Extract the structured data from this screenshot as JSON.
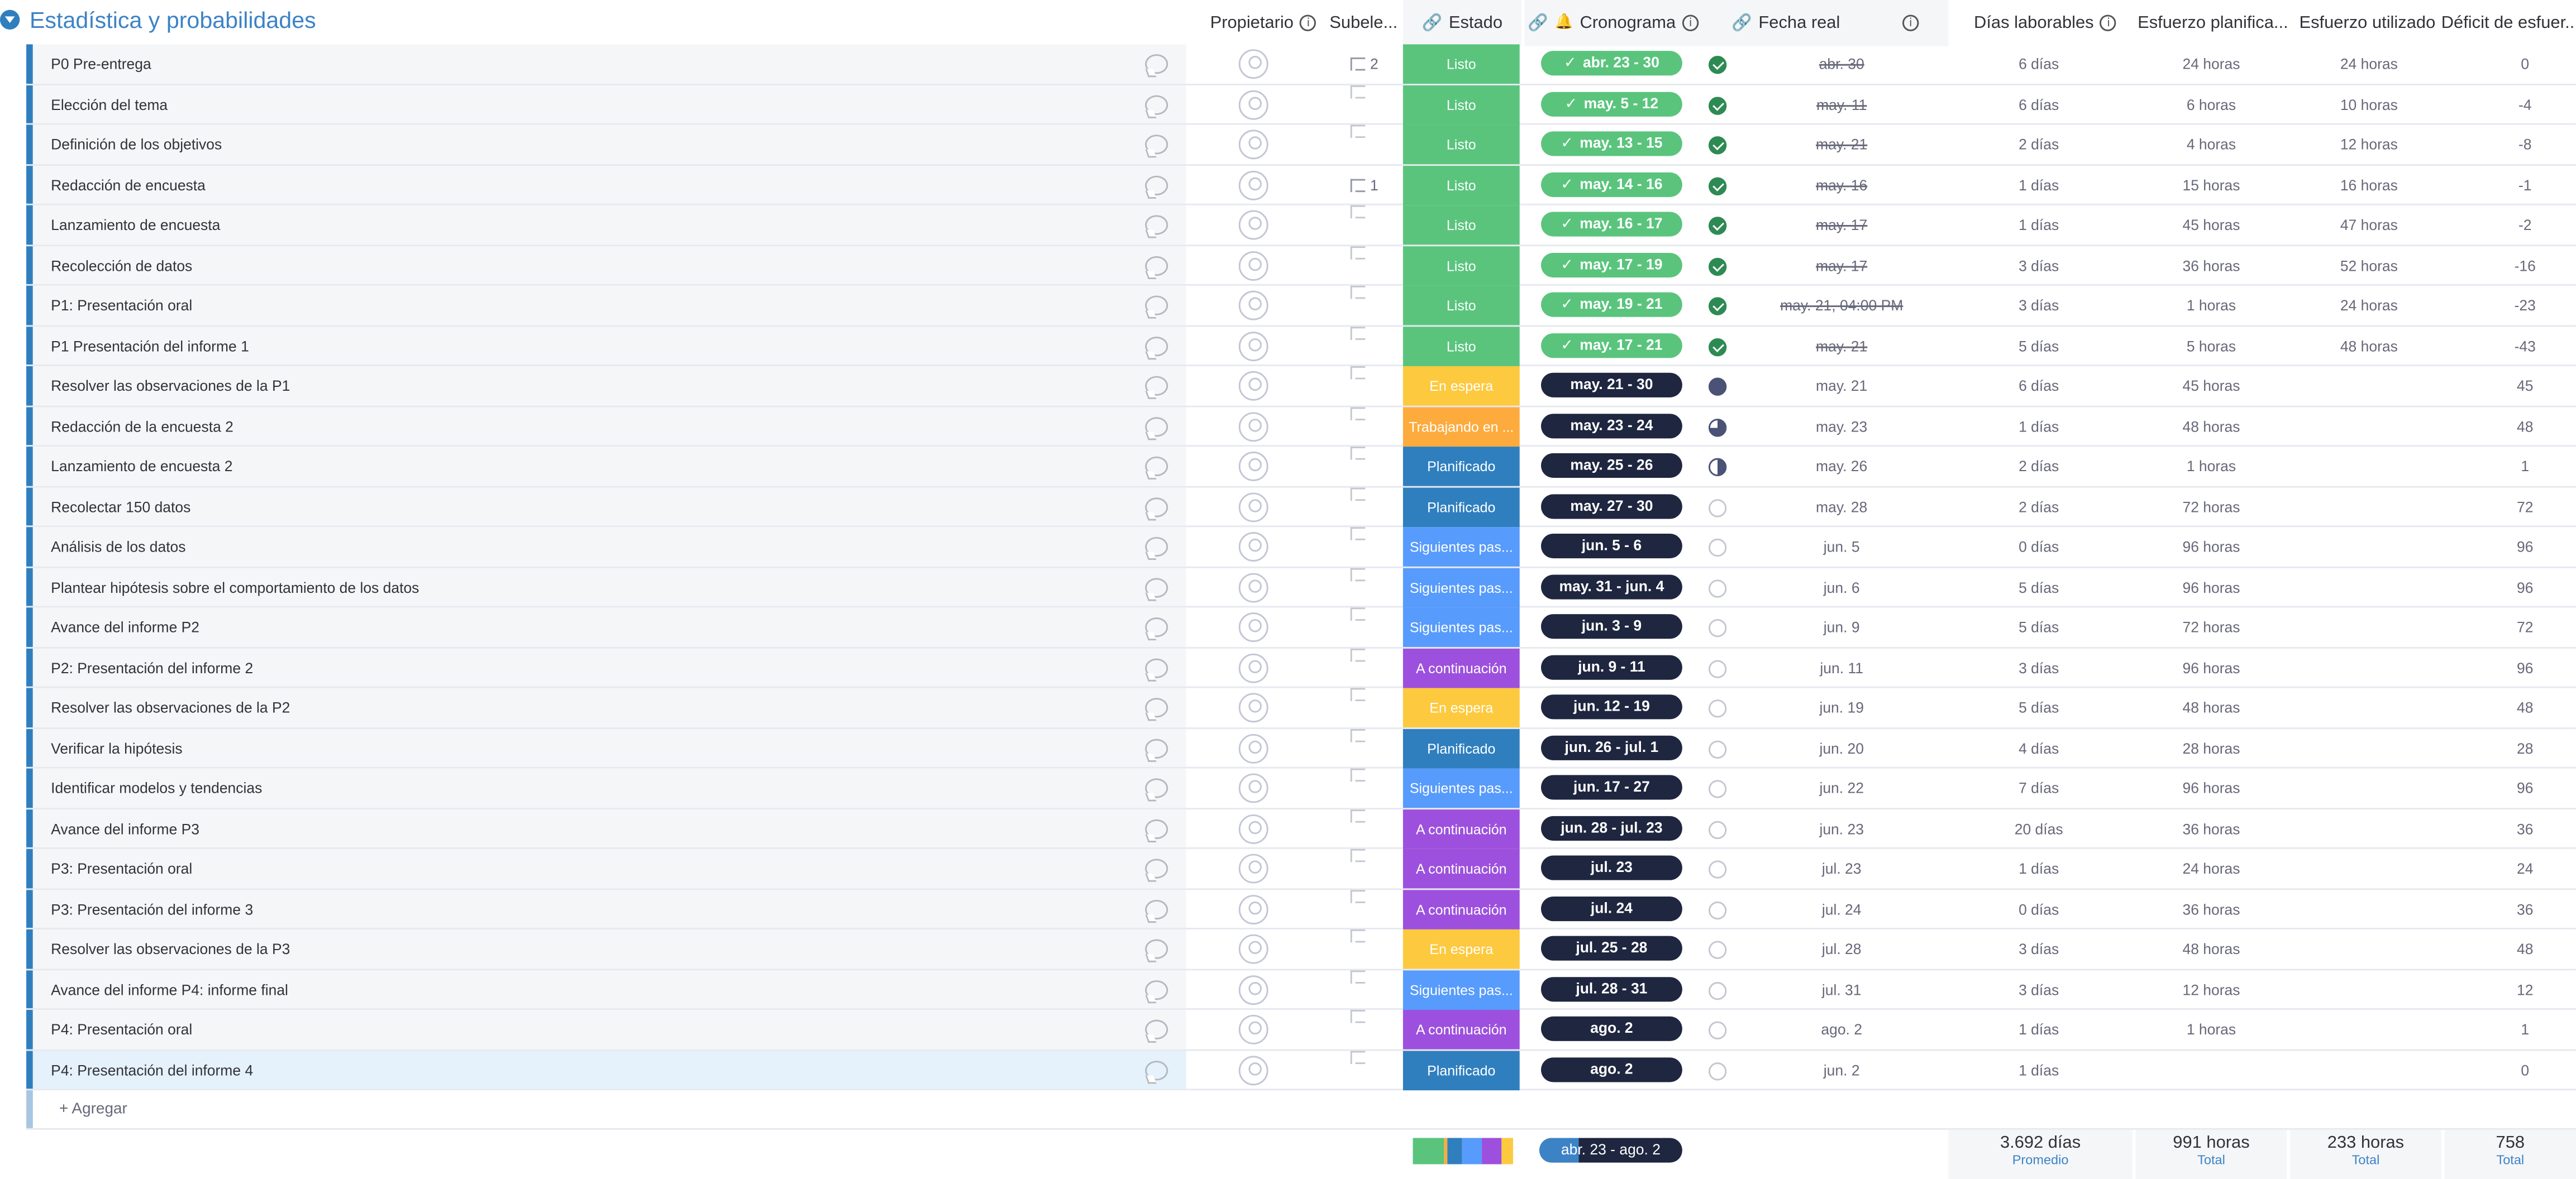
{
  "group": {
    "title": "Estadística y probabilidades"
  },
  "columns": {
    "owner": "Propietario",
    "subitems": "Subele...",
    "status": "Estado",
    "timeline": "Cronograma",
    "actual_date": "Fecha real",
    "workdays": "Días laborables",
    "planned_effort": "Esfuerzo planifica...",
    "used_effort": "Esfuerzo utilizado",
    "deficit": "Déficit de esfuer..."
  },
  "status_colors": {
    "Listo": "#5ac47d",
    "En espera": "#fdc93f",
    "Trabajando en ...": "#fdab3d",
    "Planificado": "#2f7fbf",
    "Siguientes pas...": "#579bfc",
    "A continuación": "#9d50dd"
  },
  "rows": [
    {
      "name": "P0 Pre-entrega",
      "subitems": "2",
      "status": "Listo",
      "timeline": "abr. 23 - 30",
      "done": true,
      "progress": "done",
      "actual": "abr. 30",
      "workdays": "6 días",
      "planned": "24 horas",
      "used": "24 horas",
      "deficit": "0"
    },
    {
      "name": "Elección del tema",
      "subitems": "",
      "status": "Listo",
      "timeline": "may. 5 - 12",
      "done": true,
      "progress": "done",
      "actual": "may. 11",
      "workdays": "6 días",
      "planned": "6 horas",
      "used": "10 horas",
      "deficit": "-4"
    },
    {
      "name": "Definición de los objetivos",
      "subitems": "",
      "status": "Listo",
      "timeline": "may. 13 - 15",
      "done": true,
      "progress": "done",
      "actual": "may. 21",
      "workdays": "2 días",
      "planned": "4 horas",
      "used": "12 horas",
      "deficit": "-8"
    },
    {
      "name": "Redacción de encuesta",
      "subitems": "1",
      "status": "Listo",
      "timeline": "may. 14 - 16",
      "done": true,
      "progress": "done",
      "actual": "may. 16",
      "workdays": "1 días",
      "planned": "15 horas",
      "used": "16 horas",
      "deficit": "-1"
    },
    {
      "name": "Lanzamiento de encuesta",
      "subitems": "",
      "status": "Listo",
      "timeline": "may. 16 - 17",
      "done": true,
      "progress": "done",
      "actual": "may. 17",
      "workdays": "1 días",
      "planned": "45 horas",
      "used": "47 horas",
      "deficit": "-2"
    },
    {
      "name": "Recolección de datos",
      "subitems": "",
      "status": "Listo",
      "timeline": "may. 17 - 19",
      "done": true,
      "progress": "done",
      "actual": "may. 17",
      "workdays": "3 días",
      "planned": "36 horas",
      "used": "52 horas",
      "deficit": "-16"
    },
    {
      "name": "P1: Presentación oral",
      "subitems": "",
      "status": "Listo",
      "timeline": "may. 19 - 21",
      "done": true,
      "progress": "done",
      "actual": "may. 21, 04:00 PM",
      "workdays": "3 días",
      "planned": "1 horas",
      "used": "24 horas",
      "deficit": "-23"
    },
    {
      "name": "P1 Presentación del informe 1",
      "subitems": "",
      "status": "Listo",
      "timeline": "may. 17 - 21",
      "done": true,
      "progress": "done",
      "actual": "may. 21",
      "workdays": "5 días",
      "planned": "5 horas",
      "used": "48 horas",
      "deficit": "-43"
    },
    {
      "name": "Resolver las observaciones de la P1",
      "subitems": "",
      "status": "En espera",
      "timeline": "may. 21 - 30",
      "done": false,
      "progress": "p100",
      "actual": "may. 21",
      "workdays": "6 días",
      "planned": "45 horas",
      "used": "",
      "deficit": "45"
    },
    {
      "name": "Redacción de la encuesta 2",
      "subitems": "",
      "status": "Trabajando en ...",
      "timeline": "may. 23 - 24",
      "done": false,
      "progress": "p75",
      "actual": "may. 23",
      "workdays": "1 días",
      "planned": "48 horas",
      "used": "",
      "deficit": "48"
    },
    {
      "name": "Lanzamiento de encuesta 2",
      "subitems": "",
      "status": "Planificado",
      "timeline": "may. 25 - 26",
      "done": false,
      "progress": "p50",
      "actual": "may. 26",
      "workdays": "2 días",
      "planned": "1 horas",
      "used": "",
      "deficit": "1"
    },
    {
      "name": "Recolectar 150 datos",
      "subitems": "",
      "status": "Planificado",
      "timeline": "may. 27 - 30",
      "done": false,
      "progress": "empty",
      "actual": "may. 28",
      "workdays": "2 días",
      "planned": "72 horas",
      "used": "",
      "deficit": "72"
    },
    {
      "name": "Análisis de los datos",
      "subitems": "",
      "status": "Siguientes pas...",
      "timeline": "jun. 5 - 6",
      "done": false,
      "progress": "empty",
      "actual": "jun. 5",
      "workdays": "0 días",
      "planned": "96 horas",
      "used": "",
      "deficit": "96"
    },
    {
      "name": "Plantear hipótesis sobre el comportamiento de los datos",
      "subitems": "",
      "status": "Siguientes pas...",
      "timeline": "may. 31 - jun. 4",
      "done": false,
      "progress": "empty",
      "actual": "jun. 6",
      "workdays": "5 días",
      "planned": "96 horas",
      "used": "",
      "deficit": "96"
    },
    {
      "name": "Avance del informe P2",
      "subitems": "",
      "status": "Siguientes pas...",
      "timeline": "jun. 3 - 9",
      "done": false,
      "progress": "empty",
      "actual": "jun. 9",
      "workdays": "5 días",
      "planned": "72 horas",
      "used": "",
      "deficit": "72"
    },
    {
      "name": "P2: Presentación del informe 2",
      "subitems": "",
      "status": "A continuación",
      "timeline": "jun. 9 - 11",
      "done": false,
      "progress": "empty",
      "actual": "jun. 11",
      "workdays": "3 días",
      "planned": "96 horas",
      "used": "",
      "deficit": "96"
    },
    {
      "name": "Resolver las observaciones de la P2",
      "subitems": "",
      "status": "En espera",
      "timeline": "jun. 12 - 19",
      "done": false,
      "progress": "empty",
      "actual": "jun. 19",
      "workdays": "5 días",
      "planned": "48 horas",
      "used": "",
      "deficit": "48"
    },
    {
      "name": "Verificar la hipótesis",
      "subitems": "",
      "status": "Planificado",
      "timeline": "jun. 26 - jul. 1",
      "done": false,
      "progress": "empty",
      "actual": "jun. 20",
      "workdays": "4 días",
      "planned": "28 horas",
      "used": "",
      "deficit": "28"
    },
    {
      "name": "Identificar modelos y tendencias",
      "subitems": "",
      "status": "Siguientes pas...",
      "timeline": "jun. 17 - 27",
      "done": false,
      "progress": "empty",
      "actual": "jun. 22",
      "workdays": "7 días",
      "planned": "96 horas",
      "used": "",
      "deficit": "96"
    },
    {
      "name": "Avance del informe P3",
      "subitems": "",
      "status": "A continuación",
      "timeline": "jun. 28 - jul. 23",
      "done": false,
      "progress": "empty",
      "actual": "jun. 23",
      "workdays": "20 días",
      "planned": "36 horas",
      "used": "",
      "deficit": "36"
    },
    {
      "name": "P3: Presentación oral",
      "subitems": "",
      "status": "A continuación",
      "timeline": "jul. 23",
      "done": false,
      "progress": "empty",
      "actual": "jul. 23",
      "workdays": "1 días",
      "planned": "24 horas",
      "used": "",
      "deficit": "24"
    },
    {
      "name": "P3: Presentación del informe 3",
      "subitems": "",
      "status": "A continuación",
      "timeline": "jul. 24",
      "done": false,
      "progress": "empty",
      "actual": "jul. 24",
      "workdays": "0 días",
      "planned": "36 horas",
      "used": "",
      "deficit": "36"
    },
    {
      "name": "Resolver las observaciones de la P3",
      "subitems": "",
      "status": "En espera",
      "timeline": "jul. 25 - 28",
      "done": false,
      "progress": "empty",
      "actual": "jul. 28",
      "workdays": "3 días",
      "planned": "48 horas",
      "used": "",
      "deficit": "48"
    },
    {
      "name": "Avance del informe P4: informe final",
      "subitems": "",
      "status": "Siguientes pas...",
      "timeline": "jul. 28 - 31",
      "done": false,
      "progress": "empty",
      "actual": "jul. 31",
      "workdays": "3 días",
      "planned": "12 horas",
      "used": "",
      "deficit": "12"
    },
    {
      "name": "P4: Presentación oral",
      "subitems": "",
      "status": "A continuación",
      "timeline": "ago. 2",
      "done": false,
      "progress": "empty",
      "actual": "ago. 2",
      "workdays": "1 días",
      "planned": "1 horas",
      "used": "",
      "deficit": "1"
    },
    {
      "name": "P4: Presentación del informe 4",
      "subitems": "",
      "status": "Planificado",
      "timeline": "ago. 2",
      "done": false,
      "progress": "empty",
      "actual": "jun. 2",
      "workdays": "1 días",
      "planned": "",
      "used": "",
      "deficit": "0"
    }
  ],
  "add_row": {
    "label": "+ Agregar"
  },
  "summary": {
    "status_segments": [
      {
        "color": "#5ac47d",
        "share": 0.31
      },
      {
        "color": "#fdab3d",
        "share": 0.04
      },
      {
        "color": "#2f7fbf",
        "share": 0.15
      },
      {
        "color": "#579bfc",
        "share": 0.19
      },
      {
        "color": "#9d50dd",
        "share": 0.19
      },
      {
        "color": "#fdc93f",
        "share": 0.12
      }
    ],
    "timeline": "abr. 23 - ago. 2",
    "timeline_progress": 0.28,
    "workdays_value": "3.692 días",
    "workdays_label": "Promedio",
    "planned_value": "991 horas",
    "planned_label": "Total",
    "used_value": "233 horas",
    "used_label": "Total",
    "deficit_value": "758",
    "deficit_label": "Total"
  }
}
